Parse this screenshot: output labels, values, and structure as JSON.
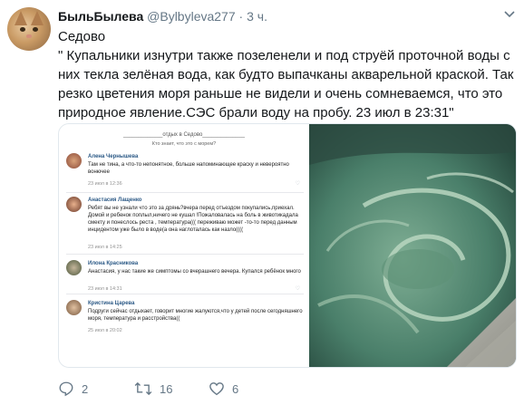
{
  "tweet": {
    "display_name": "БыльБылева",
    "handle": "@Bylbyleva277",
    "separator": "·",
    "time": "3 ч.",
    "text_line1": "Седово",
    "text_line2": " \" Купальники изнутри также позеленели и под струёй проточной воды с них текла зелёная вода, как будто выпачканы акварельной краской. Так резко цветения моря раньше не видели и очень сомневаемся, что это природное явление.СЭС брали воду на пробу. 23 июл в 23:31\""
  },
  "vk_screenshot": {
    "header": "_____________отдых в Седово______________",
    "subheader": "Кто знает, что это с морем?",
    "posts": [
      {
        "author": "Алена Чернышева",
        "text": "Там не тина, а что-то непонятное, больше напоминающее краску и невероятно вонючее",
        "date": "23 июл в 12:36"
      },
      {
        "author": "Анастасия Лащенко",
        "text": "Ребят вы не узнали что это за дрянь?вчера перед отъездом покупались,приехал. Домой и ребенок поплыл,ничего не кушал !Пожаловалась на боль в животикадала смекту и понеслось реста , температура((( переживаю может -то-то перед данным инцидентом уже было в воде(а она наглоталась как назло((((",
        "date": "23 июл в 14:25"
      },
      {
        "author": "Илона Красникова",
        "text": "Анастасия, у нас такие же симптомы со вчерашнего вечера. Купался ребёнок много",
        "date": "23 июл в 14:31"
      },
      {
        "author": "Кристина Царева",
        "text": "Подруги сейчас отдыхает, говорит многие жалуются,что у детей после сегодняшнего моря, температура и расстройства((",
        "date": "25 июл в 20:02"
      }
    ]
  },
  "actions": {
    "reply_count": "2",
    "retweet_count": "16",
    "like_count": "6"
  },
  "colors": {
    "secondary_text": "#657786",
    "vk_link": "#2a5885",
    "sea_green": "#4a7f6a"
  }
}
